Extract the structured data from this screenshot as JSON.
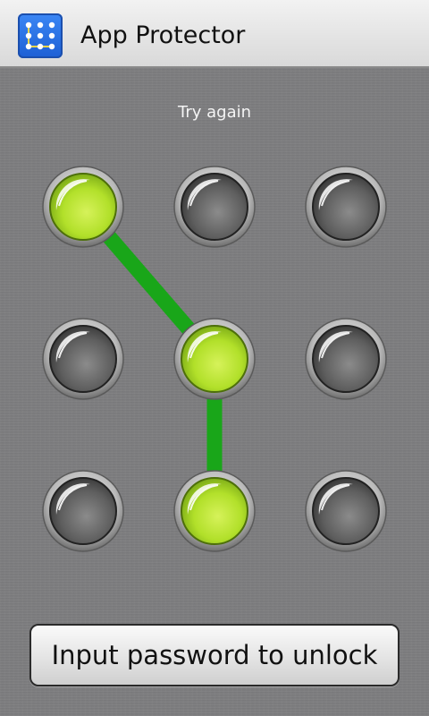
{
  "app": {
    "title": "App Protector",
    "icon": "pattern-lock-icon"
  },
  "pattern": {
    "status_text": "Try again",
    "grid_rows": 3,
    "grid_cols": 3,
    "selected_dots": [
      0,
      4,
      7
    ],
    "colors": {
      "active": "#b7e62a",
      "inactive": "#4a4a4a",
      "line": "#19a619"
    }
  },
  "button": {
    "label": "Input password to unlock"
  }
}
